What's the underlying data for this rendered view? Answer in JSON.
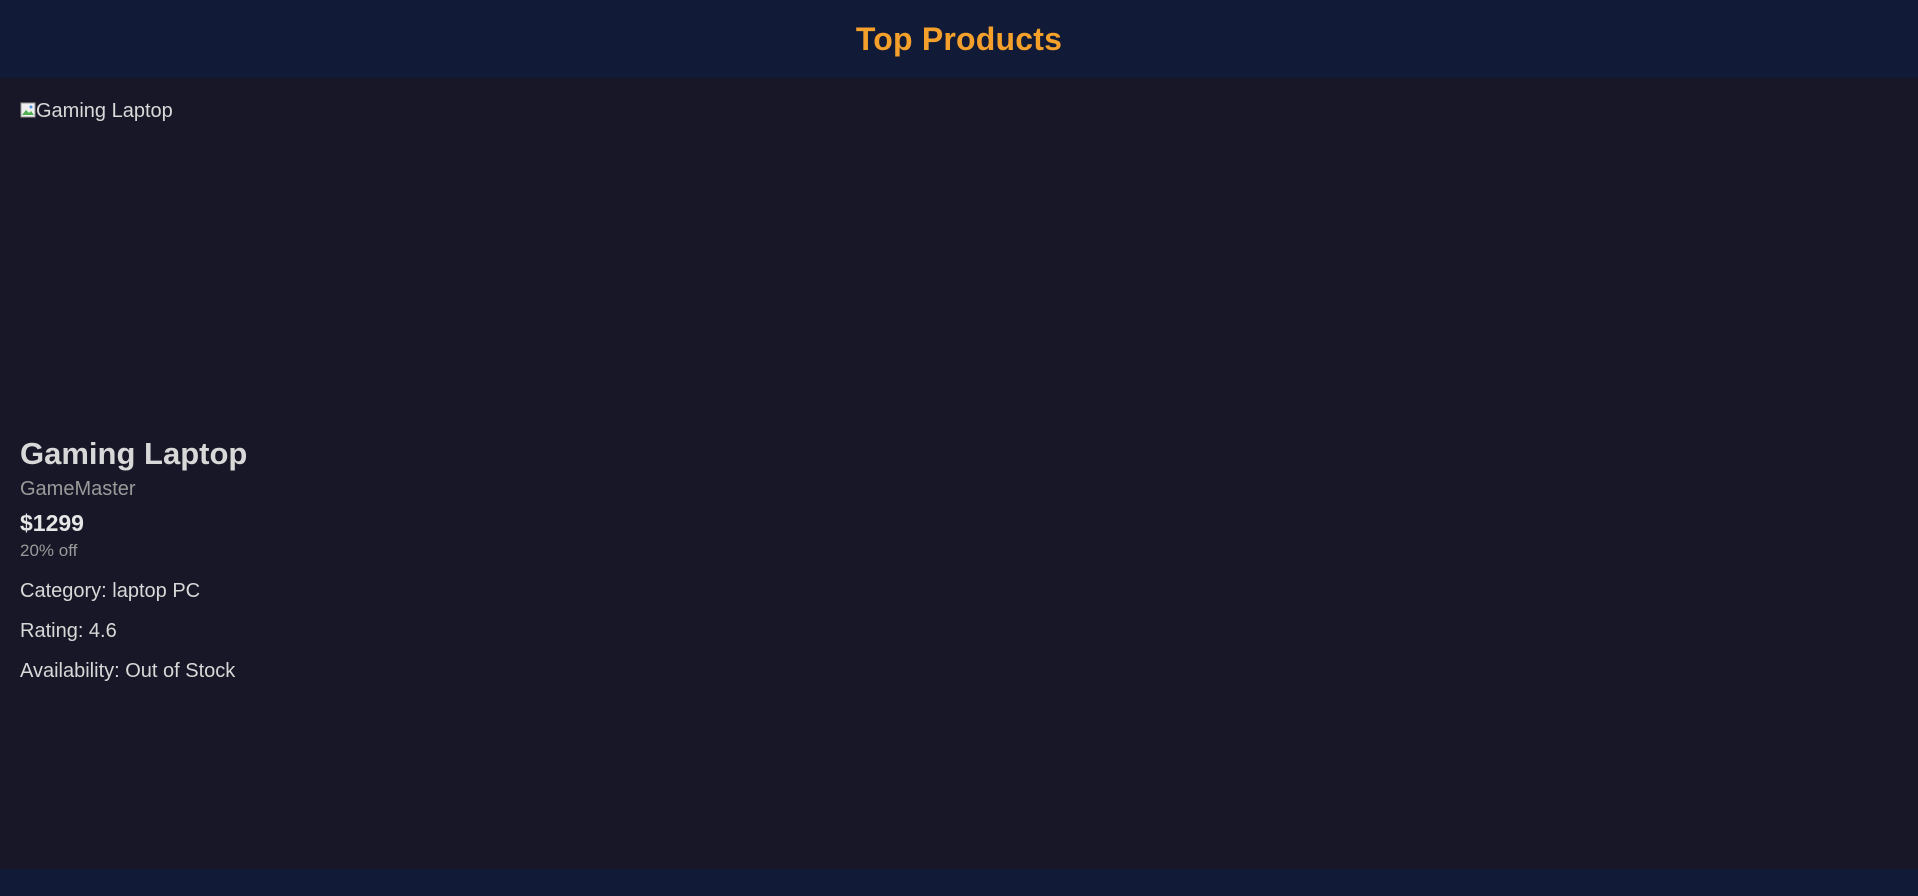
{
  "header": {
    "title": "Top Products"
  },
  "product": {
    "image_alt": "Gaming Laptop",
    "name": "Gaming Laptop",
    "brand": "GameMaster",
    "price": "$1299",
    "discount": "20% off",
    "category_label": "Category: laptop PC",
    "rating_label": "Rating: 4.6",
    "availability_label": "Availability: Out of Stock"
  },
  "colors": {
    "header_bg": "#111a36",
    "main_bg": "#171727",
    "accent": "#f5a02a"
  },
  "icons": {
    "broken_image": "broken-image-icon"
  }
}
